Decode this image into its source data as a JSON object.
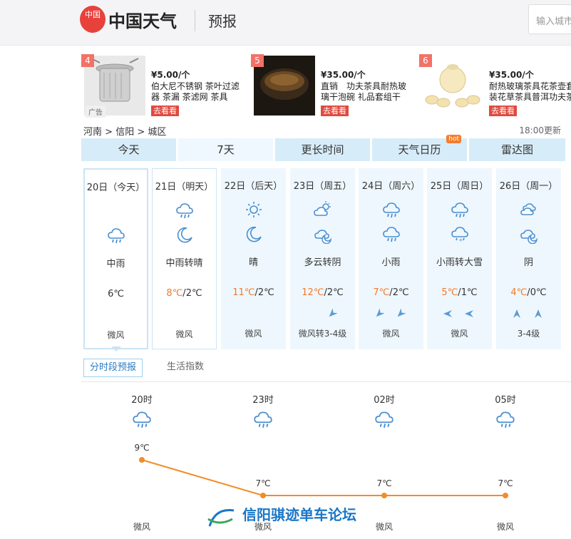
{
  "header": {
    "logo_glyphs": "中国",
    "logo_text": "中国天气",
    "section": "预报",
    "search_placeholder": "输入城市"
  },
  "ads": [
    {
      "num": "4",
      "price": "¥5.00/个",
      "desc": "伯大尼不锈钢 茶叶过滤器 茶漏 茶滤网 茶具",
      "btn": "去看看",
      "tag": "广告"
    },
    {
      "num": "5",
      "price": "¥35.00/个",
      "desc": "直销　功夫茶具耐热玻璃干泡碗 礼品套组干",
      "btn": "去看看"
    },
    {
      "num": "6",
      "price": "¥35.00/个",
      "desc": "耐热玻璃茶具花茶壶套装花草茶具普洱功夫茶",
      "btn": "去看看"
    }
  ],
  "breadcrumb": {
    "province": "河南",
    "sep1": ">",
    "city": "信阳",
    "sep2": ">",
    "district": "城区"
  },
  "update_time": "18:00更新",
  "tabs": [
    {
      "label": "今天"
    },
    {
      "label": "7天"
    },
    {
      "label": "更长时间"
    },
    {
      "label": "天气日历",
      "badge": "hot"
    },
    {
      "label": "雷达图"
    }
  ],
  "days": [
    {
      "date": "20日（今天）",
      "icons": [
        "rain-icon"
      ],
      "weather": "中雨",
      "low": "6℃",
      "wind": "微风",
      "dirs": []
    },
    {
      "date": "21日（明天）",
      "icons": [
        "rain-icon",
        "moon-icon"
      ],
      "weather": "中雨转晴",
      "high": "8℃",
      "sep": "/",
      "low": "2℃",
      "wind": "微风",
      "dirs": []
    },
    {
      "date": "22日（后天）",
      "icons": [
        "sun-icon",
        "moon-icon"
      ],
      "weather": "晴",
      "high": "11℃",
      "sep": "/",
      "low": "2℃",
      "wind": "微风",
      "dirs": []
    },
    {
      "date": "23日（周五）",
      "icons": [
        "partly-cloudy-icon",
        "cloudy-night-icon"
      ],
      "weather": "多云转阴",
      "high": "12℃",
      "sep": "/",
      "low": "2℃",
      "wind": "微风转3-4级",
      "dirs": [
        "ne"
      ]
    },
    {
      "date": "24日（周六）",
      "icons": [
        "rain-icon",
        "rain-icon"
      ],
      "weather": "小雨",
      "high": "7℃",
      "sep": "/",
      "low": "2℃",
      "wind": "微风",
      "dirs": [
        "ne",
        "ne"
      ]
    },
    {
      "date": "25日（周日）",
      "icons": [
        "rain-icon",
        "snow-icon"
      ],
      "weather": "小雨转大雪",
      "high": "5℃",
      "sep": "/",
      "low": "1℃",
      "wind": "微风",
      "dirs": [
        "e",
        "e"
      ]
    },
    {
      "date": "26日（周一）",
      "icons": [
        "cloud-icon",
        "cloudy-night-icon"
      ],
      "weather": "阴",
      "high": "4℃",
      "sep": "/",
      "low": "0℃",
      "wind": "3-4级",
      "dirs": [
        "n",
        "n"
      ]
    }
  ],
  "subtabs": [
    {
      "label": "分时段预报"
    },
    {
      "label": "生活指数"
    }
  ],
  "hourly": [
    {
      "time": "20时",
      "temp": "9℃",
      "t": 9,
      "wind": "微风"
    },
    {
      "time": "23时",
      "temp": "7℃",
      "t": 7,
      "wind": "微风"
    },
    {
      "time": "02时",
      "temp": "7℃",
      "t": 7,
      "wind": "微风"
    },
    {
      "time": "05时",
      "temp": "7℃",
      "t": 7,
      "wind": "微风"
    }
  ],
  "watermark": "信阳骐迹单车论坛",
  "colors": {
    "accent": "#2a7cc1",
    "temp_high": "#f27a2a",
    "line": "#f28c28",
    "tab_bg": "#d7ecf9"
  }
}
